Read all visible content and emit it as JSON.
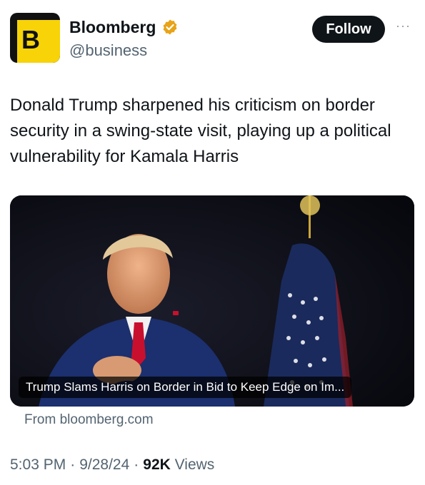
{
  "author": {
    "avatar_letter": "B",
    "name": "Bloomberg",
    "handle": "@business",
    "verified_icon": "verified-badge-icon",
    "colors": {
      "avatar_bg": "#111111",
      "avatar_accent": "#f7d308",
      "badge": "#e8a317"
    }
  },
  "actions": {
    "follow_label": "Follow",
    "more_label": "···"
  },
  "tweet": {
    "text": "Donald Trump sharpened his criticism on border security in a swing-state visit, playing up a political vulnerability for Kamala Harris"
  },
  "card": {
    "headline": "Trump Slams Harris on Border in Bid to Keep Edge on Im...",
    "source": "From bloomberg.com"
  },
  "meta": {
    "time": "5:03 PM",
    "date": "9/28/24",
    "view_count": "92K",
    "views_label": "Views",
    "separator": "·"
  }
}
